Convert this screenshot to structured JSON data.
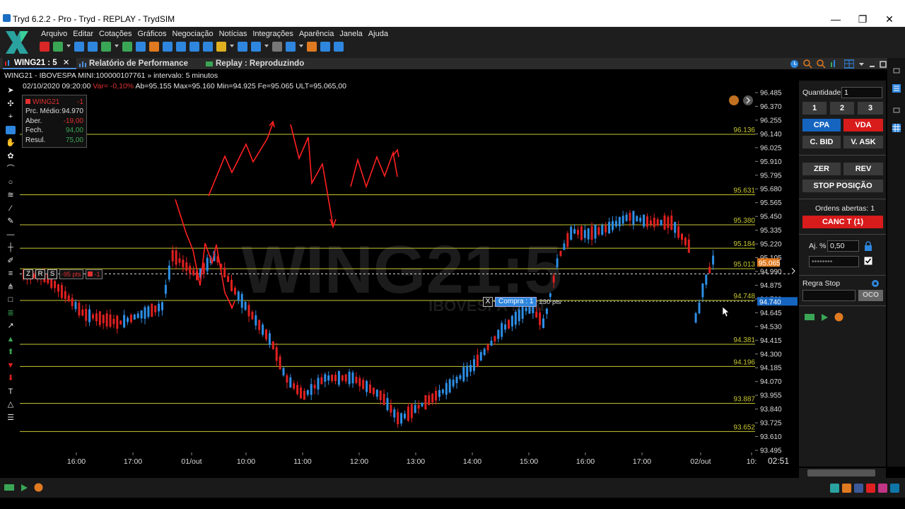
{
  "window": {
    "title": "Tryd 6.2.2 - Pro - Tryd - REPLAY - TrydSIM",
    "minimize": "—",
    "maximize": "❐",
    "close": "✕"
  },
  "menu": [
    "Arquivo",
    "Editar",
    "Cotações",
    "Gráficos",
    "Negociação",
    "Notícias",
    "Integrações",
    "Aparência",
    "Janela",
    "Ajuda"
  ],
  "tabs": {
    "chart_tab": "WING21 : 5",
    "chart_tab_close": "✕",
    "performance_tab": "Relatório de Performance",
    "replay_tab": "Replay : Reproduzindo"
  },
  "chart_subtitle": "WING21 - IBOVESPA MINI:100000107761 » intervalo: 5 minutos",
  "info_line": {
    "datetime": "02/10/2020 09:20:00",
    "var": "Var= -0,10%",
    "ab": "Ab=95.155",
    "max": "Max=95.160",
    "min": "Min=94.925",
    "fe": "Fe=95.065",
    "ult": "ULT=95.065,00"
  },
  "position_box": {
    "symbol": "WING21",
    "qty": "-1",
    "rows": [
      {
        "label": "Prc. Médio:",
        "value": "94.970",
        "tone": "white"
      },
      {
        "label": "Aber.",
        "value": "-19,00",
        "tone": "red"
      },
      {
        "label": "Fech.",
        "value": "94,00",
        "tone": "green"
      },
      {
        "label": "Resul.",
        "value": "75,00",
        "tone": "green"
      }
    ]
  },
  "order_bar": {
    "z": "Z",
    "r": "R",
    "s": "S",
    "pts": "-95 pts",
    "qty": "-1"
  },
  "compra_order": {
    "x": "X",
    "label": "Compra : 1",
    "pts": "230 pts"
  },
  "watermark": {
    "main": "WING21:5",
    "sub": "IBOVESPA MINI"
  },
  "chart_data": {
    "type": "candlestick",
    "symbol": "WING21",
    "interval": "5 minutos",
    "ylim": [
      93.495,
      96.485
    ],
    "y_ticks": [
      "96.485",
      "96.370",
      "96.255",
      "96.140",
      "96.025",
      "95.910",
      "95.795",
      "95.680",
      "95.565",
      "95.450",
      "95.335",
      "95.220",
      "95.105",
      "94.990",
      "94.875",
      "94.760",
      "94.645",
      "94.530",
      "94.415",
      "94.300",
      "94.185",
      "94.070",
      "93.955",
      "93.840",
      "93.725",
      "93.610",
      "93.495"
    ],
    "x_ticks": [
      "16:00",
      "17:00",
      "01/out",
      "10:00",
      "11:00",
      "12:00",
      "13:00",
      "14:00",
      "15:00",
      "16:00",
      "17:00",
      "02/out",
      "10:"
    ],
    "current_time": "02:51",
    "horizontal_levels": [
      "96.136",
      "95.631",
      "95.380",
      "95.184",
      "95.013",
      "94.748",
      "94.381",
      "94.196",
      "93.887",
      "93.652"
    ],
    "last_price": "95.065",
    "order_price": "94.740",
    "avg_price_line": 94.97,
    "colors": {
      "up": "#2e8fe6",
      "down": "#e02020",
      "level": "#c8c832",
      "last_price_bg": "#e07a20",
      "order_bg": "#1565c0"
    }
  },
  "right_panel": {
    "qty_label": "Quantidade",
    "qty_value": "1",
    "qty_buttons": [
      "1",
      "2",
      "3"
    ],
    "cpa": "CPA",
    "vda": "VDA",
    "cbid": "C. BID",
    "vask": "V. ASK",
    "zer": "ZER",
    "rev": "REV",
    "stop": "STOP POSIÇÃO",
    "open_orders": "Ordens abertas: 1",
    "canc": "CANC T (1)",
    "aj_label": "Aj. %",
    "aj_value": "0,50",
    "password": "••••••••",
    "regra_stop": "Regra Stop",
    "oco": "OCO"
  }
}
